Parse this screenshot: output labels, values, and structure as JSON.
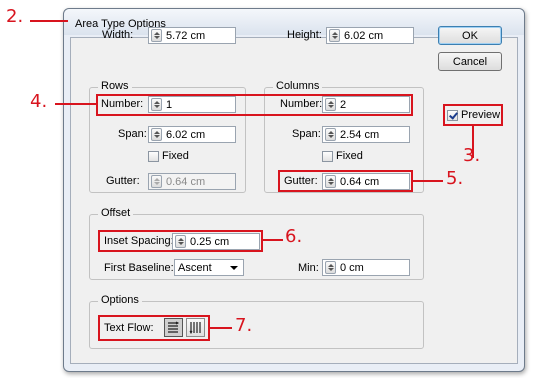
{
  "dialog": {
    "title": "Area Type Options",
    "width_label": "Width:",
    "width_value": "5.72 cm",
    "height_label": "Height:",
    "height_value": "6.02 cm"
  },
  "rows": {
    "title": "Rows",
    "number_label": "Number:",
    "number_value": "1",
    "span_label": "Span:",
    "span_value": "6.02 cm",
    "fixed_label": "Fixed",
    "gutter_label": "Gutter:",
    "gutter_value": "0.64 cm"
  },
  "columns": {
    "title": "Columns",
    "number_label": "Number:",
    "number_value": "2",
    "span_label": "Span:",
    "span_value": "2.54 cm",
    "fixed_label": "Fixed",
    "gutter_label": "Gutter:",
    "gutter_value": "0.64 cm"
  },
  "offset": {
    "title": "Offset",
    "inset_label": "Inset Spacing:",
    "inset_value": "0.25 cm",
    "first_baseline_label": "First Baseline:",
    "first_baseline_value": "Ascent",
    "min_label": "Min:",
    "min_value": "0 cm"
  },
  "options": {
    "title": "Options",
    "text_flow_label": "Text Flow:"
  },
  "buttons": {
    "ok": "OK",
    "cancel": "Cancel",
    "preview": "Preview"
  },
  "callouts": {
    "c2": "2.",
    "c3": "3.",
    "c4": "4.",
    "c5": "5.",
    "c6": "6.",
    "c7": "7."
  },
  "colors": {
    "highlight": "#d8141e",
    "dialog_bg": "#f0f0f0"
  }
}
